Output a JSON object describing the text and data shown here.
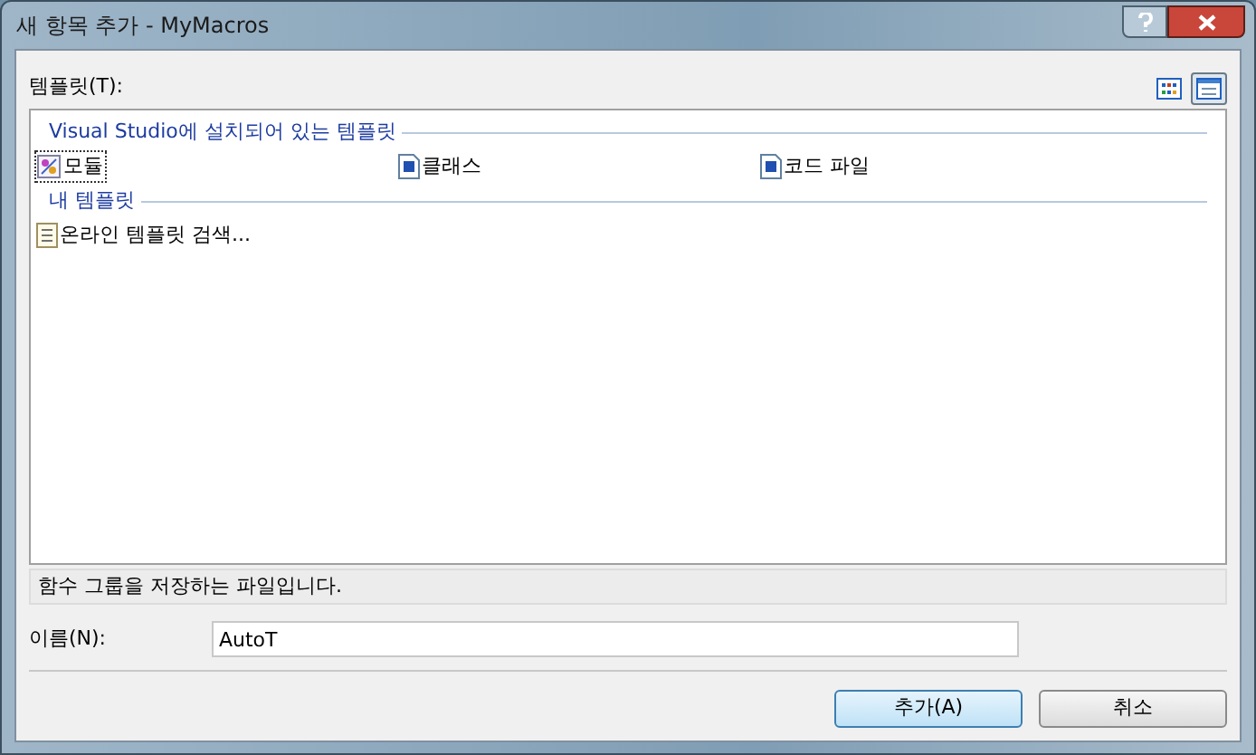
{
  "window": {
    "title": "새 항목 추가 - MyMacros"
  },
  "templates_label": "템플릿(T):",
  "view_buttons": [
    {
      "kind": "icons",
      "selected": false
    },
    {
      "kind": "list",
      "selected": true
    }
  ],
  "groups": [
    {
      "title": "Visual Studio에 설치되어 있는 템플릿",
      "items": [
        {
          "label": "모듈",
          "kind": "module",
          "selected": true
        },
        {
          "label": "클래스",
          "kind": "class",
          "selected": false
        },
        {
          "label": "코드 파일",
          "kind": "code",
          "selected": false
        }
      ]
    },
    {
      "title": "내 템플릿",
      "items": [
        {
          "label": "온라인 템플릿 검색...",
          "kind": "search",
          "selected": false
        }
      ]
    }
  ],
  "description": "함수 그룹을 저장하는 파일입니다.",
  "name_field": {
    "label": "이름(N):",
    "value": "AutoT"
  },
  "buttons": [
    {
      "label": "추가(A)",
      "kind": "default"
    },
    {
      "label": "취소",
      "kind": "normal"
    }
  ]
}
